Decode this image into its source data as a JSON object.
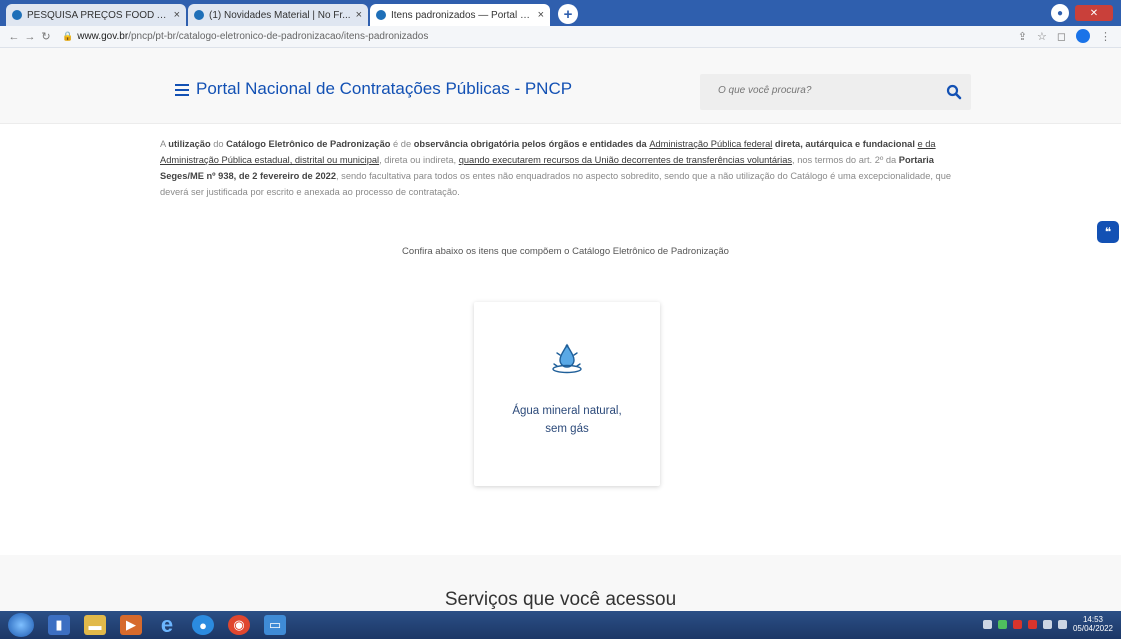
{
  "browser": {
    "tabs": [
      {
        "title": "PESQUISA PREÇOS FOOD ATUALI...",
        "active": false
      },
      {
        "title": "(1) Novidades Material | No Fr...",
        "active": false
      },
      {
        "title": "Itens padronizados — Portal Na...",
        "active": true
      }
    ],
    "address": {
      "domain": "www.gov.br",
      "path": "/pncp/pt-br/catalogo-eletronico-de-padronizacao/itens-padronizados"
    },
    "accent_color": "#2f5fae"
  },
  "header": {
    "site_title": "Portal Nacional de Contratações Públicas - PNCP",
    "search_placeholder": "O que você procura?",
    "brand_color": "#1351b4"
  },
  "intro": {
    "s1": "A ",
    "s2": "utilização",
    "s3": " do ",
    "s4": "Catálogo Eletrônico de Padronização",
    "s5": " é de ",
    "s6": "observância obrigatória pelos órgãos e entidades da ",
    "s7": "Administração Pública federal",
    "s8": " direta, autárquica e fundacional ",
    "s9": "e da Administração Pública estadual, distrital ou municipal",
    "s10": ", direta ou indireta, ",
    "s11": "quando executarem recursos da União decorrentes de transferências voluntárias",
    "s12": ", nos termos do art. 2º da ",
    "s13": "Portaria Seges/ME nº 938, de 2 fevereiro de 2022",
    "s14": ", sendo facultativa para todos os entes não enquadrados no aspecto sobredito, sendo que a não utilização do Catálogo é uma excepcionalidade, que deverá ser justificada por escrito e anexada ao processo de contratação."
  },
  "subtitle": "Confira abaixo os itens que compõem o Catálogo Eletrônico de Padronização",
  "card": {
    "label": "Água mineral natural,\nsem gás",
    "icon": "water-drop-icon"
  },
  "services_title": "Serviços que você acessou",
  "taskbar": {
    "time": "14:53",
    "date": "05/04/2022"
  }
}
